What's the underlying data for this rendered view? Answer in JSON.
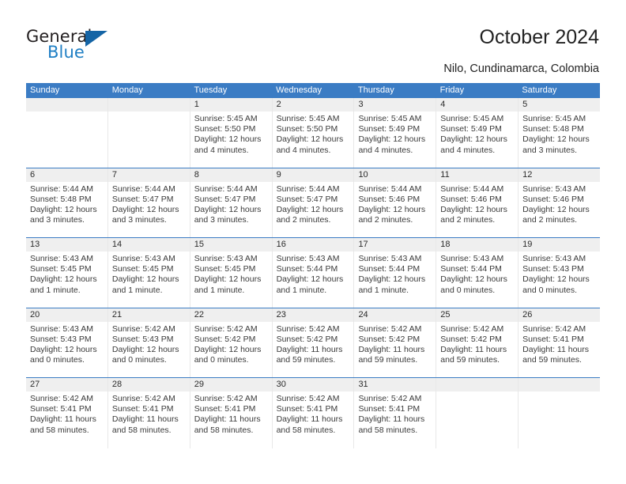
{
  "brand": {
    "name_part1": "General",
    "name_part2": "Blue",
    "logo_icon": "triangle-icon",
    "color_dark": "#231f20",
    "color_blue": "#1f7fc4",
    "color_triangle": "#1464a5"
  },
  "header": {
    "title": "October 2024",
    "subtitle": "Nilo, Cundinamarca, Colombia"
  },
  "theme": {
    "header_blue": "#3b7cc4",
    "daynum_band": "#efefef",
    "text": "#3a3a3a"
  },
  "calendar": {
    "weekday_headers": [
      "Sunday",
      "Monday",
      "Tuesday",
      "Wednesday",
      "Thursday",
      "Friday",
      "Saturday"
    ],
    "weeks": [
      [
        {
          "day": "",
          "lines": []
        },
        {
          "day": "",
          "lines": []
        },
        {
          "day": "1",
          "lines": [
            "Sunrise: 5:45 AM",
            "Sunset: 5:50 PM",
            "Daylight: 12 hours",
            "and 4 minutes."
          ]
        },
        {
          "day": "2",
          "lines": [
            "Sunrise: 5:45 AM",
            "Sunset: 5:50 PM",
            "Daylight: 12 hours",
            "and 4 minutes."
          ]
        },
        {
          "day": "3",
          "lines": [
            "Sunrise: 5:45 AM",
            "Sunset: 5:49 PM",
            "Daylight: 12 hours",
            "and 4 minutes."
          ]
        },
        {
          "day": "4",
          "lines": [
            "Sunrise: 5:45 AM",
            "Sunset: 5:49 PM",
            "Daylight: 12 hours",
            "and 4 minutes."
          ]
        },
        {
          "day": "5",
          "lines": [
            "Sunrise: 5:45 AM",
            "Sunset: 5:48 PM",
            "Daylight: 12 hours",
            "and 3 minutes."
          ]
        }
      ],
      [
        {
          "day": "6",
          "lines": [
            "Sunrise: 5:44 AM",
            "Sunset: 5:48 PM",
            "Daylight: 12 hours",
            "and 3 minutes."
          ]
        },
        {
          "day": "7",
          "lines": [
            "Sunrise: 5:44 AM",
            "Sunset: 5:47 PM",
            "Daylight: 12 hours",
            "and 3 minutes."
          ]
        },
        {
          "day": "8",
          "lines": [
            "Sunrise: 5:44 AM",
            "Sunset: 5:47 PM",
            "Daylight: 12 hours",
            "and 3 minutes."
          ]
        },
        {
          "day": "9",
          "lines": [
            "Sunrise: 5:44 AM",
            "Sunset: 5:47 PM",
            "Daylight: 12 hours",
            "and 2 minutes."
          ]
        },
        {
          "day": "10",
          "lines": [
            "Sunrise: 5:44 AM",
            "Sunset: 5:46 PM",
            "Daylight: 12 hours",
            "and 2 minutes."
          ]
        },
        {
          "day": "11",
          "lines": [
            "Sunrise: 5:44 AM",
            "Sunset: 5:46 PM",
            "Daylight: 12 hours",
            "and 2 minutes."
          ]
        },
        {
          "day": "12",
          "lines": [
            "Sunrise: 5:43 AM",
            "Sunset: 5:46 PM",
            "Daylight: 12 hours",
            "and 2 minutes."
          ]
        }
      ],
      [
        {
          "day": "13",
          "lines": [
            "Sunrise: 5:43 AM",
            "Sunset: 5:45 PM",
            "Daylight: 12 hours",
            "and 1 minute."
          ]
        },
        {
          "day": "14",
          "lines": [
            "Sunrise: 5:43 AM",
            "Sunset: 5:45 PM",
            "Daylight: 12 hours",
            "and 1 minute."
          ]
        },
        {
          "day": "15",
          "lines": [
            "Sunrise: 5:43 AM",
            "Sunset: 5:45 PM",
            "Daylight: 12 hours",
            "and 1 minute."
          ]
        },
        {
          "day": "16",
          "lines": [
            "Sunrise: 5:43 AM",
            "Sunset: 5:44 PM",
            "Daylight: 12 hours",
            "and 1 minute."
          ]
        },
        {
          "day": "17",
          "lines": [
            "Sunrise: 5:43 AM",
            "Sunset: 5:44 PM",
            "Daylight: 12 hours",
            "and 1 minute."
          ]
        },
        {
          "day": "18",
          "lines": [
            "Sunrise: 5:43 AM",
            "Sunset: 5:44 PM",
            "Daylight: 12 hours",
            "and 0 minutes."
          ]
        },
        {
          "day": "19",
          "lines": [
            "Sunrise: 5:43 AM",
            "Sunset: 5:43 PM",
            "Daylight: 12 hours",
            "and 0 minutes."
          ]
        }
      ],
      [
        {
          "day": "20",
          "lines": [
            "Sunrise: 5:43 AM",
            "Sunset: 5:43 PM",
            "Daylight: 12 hours",
            "and 0 minutes."
          ]
        },
        {
          "day": "21",
          "lines": [
            "Sunrise: 5:42 AM",
            "Sunset: 5:43 PM",
            "Daylight: 12 hours",
            "and 0 minutes."
          ]
        },
        {
          "day": "22",
          "lines": [
            "Sunrise: 5:42 AM",
            "Sunset: 5:42 PM",
            "Daylight: 12 hours",
            "and 0 minutes."
          ]
        },
        {
          "day": "23",
          "lines": [
            "Sunrise: 5:42 AM",
            "Sunset: 5:42 PM",
            "Daylight: 11 hours",
            "and 59 minutes."
          ]
        },
        {
          "day": "24",
          "lines": [
            "Sunrise: 5:42 AM",
            "Sunset: 5:42 PM",
            "Daylight: 11 hours",
            "and 59 minutes."
          ]
        },
        {
          "day": "25",
          "lines": [
            "Sunrise: 5:42 AM",
            "Sunset: 5:42 PM",
            "Daylight: 11 hours",
            "and 59 minutes."
          ]
        },
        {
          "day": "26",
          "lines": [
            "Sunrise: 5:42 AM",
            "Sunset: 5:41 PM",
            "Daylight: 11 hours",
            "and 59 minutes."
          ]
        }
      ],
      [
        {
          "day": "27",
          "lines": [
            "Sunrise: 5:42 AM",
            "Sunset: 5:41 PM",
            "Daylight: 11 hours",
            "and 58 minutes."
          ]
        },
        {
          "day": "28",
          "lines": [
            "Sunrise: 5:42 AM",
            "Sunset: 5:41 PM",
            "Daylight: 11 hours",
            "and 58 minutes."
          ]
        },
        {
          "day": "29",
          "lines": [
            "Sunrise: 5:42 AM",
            "Sunset: 5:41 PM",
            "Daylight: 11 hours",
            "and 58 minutes."
          ]
        },
        {
          "day": "30",
          "lines": [
            "Sunrise: 5:42 AM",
            "Sunset: 5:41 PM",
            "Daylight: 11 hours",
            "and 58 minutes."
          ]
        },
        {
          "day": "31",
          "lines": [
            "Sunrise: 5:42 AM",
            "Sunset: 5:41 PM",
            "Daylight: 11 hours",
            "and 58 minutes."
          ]
        },
        {
          "day": "",
          "lines": []
        },
        {
          "day": "",
          "lines": []
        }
      ]
    ]
  }
}
